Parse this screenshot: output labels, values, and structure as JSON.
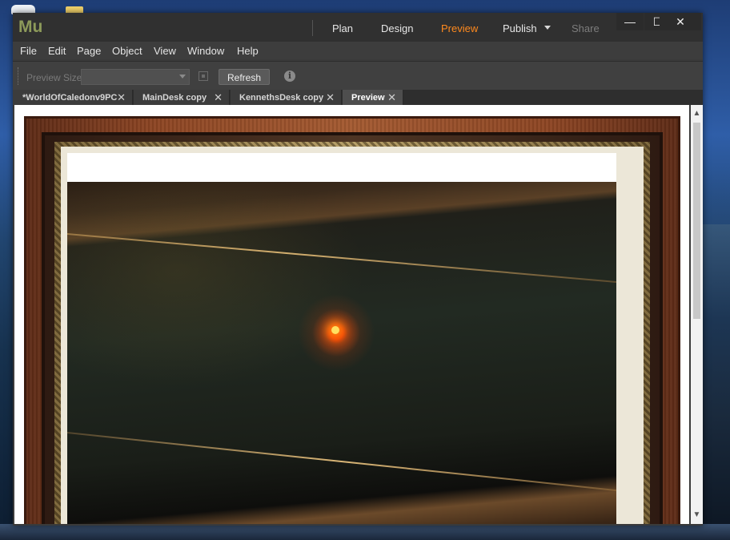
{
  "app": {
    "logo": "Mu",
    "modes": [
      "Plan",
      "Design",
      "Preview",
      "Publish",
      "Share"
    ],
    "active_mode": "Preview",
    "disabled_mode": "Share"
  },
  "window_controls": {
    "minimize": "—",
    "maximize": "☐",
    "close": "✕"
  },
  "menu": [
    "File",
    "Edit",
    "Page",
    "Object",
    "View",
    "Window",
    "Help"
  ],
  "toolbar": {
    "preview_size_label": "Preview Size:",
    "preview_size_value": "",
    "refresh_label": "Refresh",
    "info_icon": "i"
  },
  "tabs": [
    {
      "label": "*WorldOfCaledonv9PC",
      "close": "✕"
    },
    {
      "label": "MainDesk copy",
      "close": "✕"
    },
    {
      "label": "KennethsDesk copy",
      "close": "✕"
    },
    {
      "label": "Preview",
      "close": "✕",
      "active": true
    }
  ],
  "scrollbar": {
    "up": "▲",
    "down": "▼"
  },
  "colors": {
    "accent": "#ff8a1e",
    "chrome": "#3a3a3a",
    "frame_wood": "#8d4523"
  }
}
